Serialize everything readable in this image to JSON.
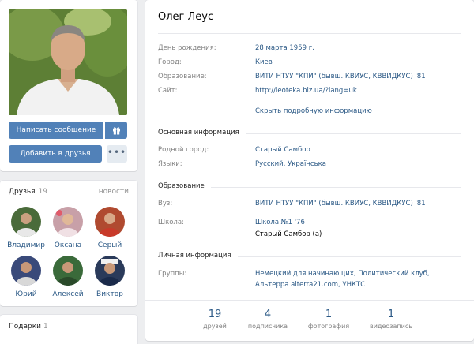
{
  "profile": {
    "name": "Олег Леус",
    "buttons": {
      "message": "Написать сообщение",
      "add_friend": "Добавить в друзья",
      "more": "•••"
    }
  },
  "info": {
    "rows": [
      {
        "label": "День рождения:",
        "value": "28 марта 1959 г."
      },
      {
        "label": "Город:",
        "value": "Киев"
      },
      {
        "label": "Образование:",
        "value": "ВИТИ НТУУ \"КПИ\" (бывш. КВИУС, КВВИДКУС) '81"
      },
      {
        "label": "Сайт:",
        "value": "http://leoteka.biz.ua/?lang=uk"
      }
    ],
    "show_more": "Скрыть подробную информацию"
  },
  "sections": {
    "main": {
      "title": "Основная информация",
      "rows": [
        {
          "label": "Родной город:",
          "value": "Старый Самбор"
        },
        {
          "label": "Языки:",
          "value": "Русский, Українська"
        }
      ]
    },
    "education": {
      "title": "Образование",
      "university": {
        "label": "Вуз:",
        "value": "ВИТИ НТУУ \"КПИ\" (бывш. КВИУС, КВВИДКУС) '81"
      },
      "school": {
        "label": "Школа:",
        "value": "Школа №1 '76",
        "sub": "Старый Самбор (а)"
      }
    },
    "personal": {
      "title": "Личная информация",
      "groups_label": "Группы:",
      "groups_line1": "Немецкий для начинающих, Политический клуб,",
      "groups_line2": "Альтерра alterra21.com, УНКТС"
    }
  },
  "counters": [
    {
      "num": "19",
      "label": "друзей"
    },
    {
      "num": "4",
      "label": "подписчика"
    },
    {
      "num": "1",
      "label": "фотография"
    },
    {
      "num": "1",
      "label": "видеозапись"
    }
  ],
  "friends": {
    "title": "Друзья",
    "count": "19",
    "news": "новости",
    "list": [
      {
        "name": "Владимир",
        "color": "#4a6b3a"
      },
      {
        "name": "Оксана",
        "color": "#c8a0a8"
      },
      {
        "name": "Серый",
        "color": "#b04a30"
      },
      {
        "name": "Юрий",
        "color": "#3a4a7a"
      },
      {
        "name": "Алексей",
        "color": "#3a6a3a"
      },
      {
        "name": "Виктор",
        "color": "#2a3a5a"
      }
    ]
  },
  "gifts": {
    "title": "Подарки",
    "count": "1"
  },
  "colors": {
    "accent": "#5181b8",
    "link": "#2a5885",
    "label": "#828282"
  }
}
